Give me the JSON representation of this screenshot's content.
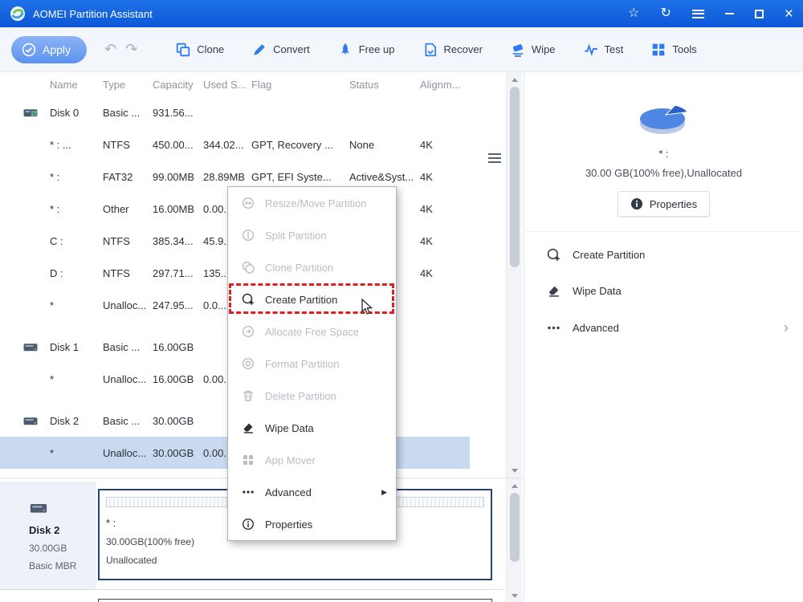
{
  "titlebar": {
    "title": "AOMEI Partition Assistant"
  },
  "toolbar": {
    "apply_label": "Apply",
    "buttons": [
      {
        "label": "Clone",
        "icon": "clone"
      },
      {
        "label": "Convert",
        "icon": "convert"
      },
      {
        "label": "Free up",
        "icon": "freeup"
      },
      {
        "label": "Recover",
        "icon": "recover"
      },
      {
        "label": "Wipe",
        "icon": "wipe"
      },
      {
        "label": "Test",
        "icon": "test"
      },
      {
        "label": "Tools",
        "icon": "tools"
      }
    ]
  },
  "table": {
    "columns": [
      "Name",
      "Type",
      "Capacity",
      "Used S...",
      "Flag",
      "Status",
      "Alignm..."
    ],
    "rows": [
      {
        "kind": "disk",
        "icon": "disk-system",
        "name": "Disk 0",
        "type": "Basic ...",
        "capacity": "931.56...",
        "used": "",
        "flag": "",
        "status": "",
        "align": ""
      },
      {
        "kind": "part",
        "name": "* : ...",
        "type": "NTFS",
        "capacity": "450.00...",
        "used": "344.02...",
        "flag": "GPT, Recovery ...",
        "status": "None",
        "align": "4K"
      },
      {
        "kind": "part",
        "name": "* :",
        "type": "FAT32",
        "capacity": "99.00MB",
        "used": "28.89MB",
        "flag": "GPT, EFI Syste...",
        "status": "Active&Syst...",
        "align": "4K"
      },
      {
        "kind": "part",
        "name": "* :",
        "type": "Other",
        "capacity": "16.00MB",
        "used": "0.00...",
        "flag": "",
        "status": "",
        "align": "4K"
      },
      {
        "kind": "part",
        "name": "C :",
        "type": "NTFS",
        "capacity": "385.34...",
        "used": "45.9...",
        "flag": "",
        "status": "",
        "align": "4K"
      },
      {
        "kind": "part",
        "name": "D :",
        "type": "NTFS",
        "capacity": "297.71...",
        "used": "135....",
        "flag": "",
        "status": "",
        "align": "4K"
      },
      {
        "kind": "part",
        "name": "*",
        "type": "Unalloc...",
        "capacity": "247.95...",
        "used": "0.0...",
        "flag": "",
        "status": "",
        "align": ""
      },
      {
        "kind": "disk",
        "icon": "disk",
        "name": "Disk 1",
        "type": "Basic ...",
        "capacity": "16.00GB",
        "used": "",
        "flag": "",
        "status": "",
        "align": ""
      },
      {
        "kind": "part",
        "name": "*",
        "type": "Unalloc...",
        "capacity": "16.00GB",
        "used": "0.00...",
        "flag": "",
        "status": "",
        "align": ""
      },
      {
        "kind": "disk",
        "icon": "disk",
        "name": "Disk 2",
        "type": "Basic ...",
        "capacity": "30.00GB",
        "used": "",
        "flag": "",
        "status": "",
        "align": ""
      },
      {
        "kind": "part",
        "name": "*",
        "type": "Unalloc...",
        "capacity": "30.00GB",
        "used": "0.00...",
        "flag": "",
        "status": "",
        "align": "",
        "selected": true
      }
    ]
  },
  "context_menu": {
    "items": [
      {
        "label": "Resize/Move Partition",
        "icon": "resize",
        "enabled": false
      },
      {
        "label": "Split Partition",
        "icon": "split",
        "enabled": false
      },
      {
        "label": "Clone Partition",
        "icon": "clonep",
        "enabled": false
      },
      {
        "label": "Create Partition",
        "icon": "create",
        "enabled": true,
        "highlighted": true
      },
      {
        "label": "Allocate Free Space",
        "icon": "allocate",
        "enabled": false
      },
      {
        "label": "Format Partition",
        "icon": "format",
        "enabled": false
      },
      {
        "label": "Delete Partition",
        "icon": "trash",
        "enabled": false
      },
      {
        "label": "Wipe Data",
        "icon": "eraser",
        "enabled": true
      },
      {
        "label": "App Mover",
        "icon": "appmover",
        "enabled": false
      },
      {
        "label": "Advanced",
        "icon": "dots",
        "enabled": true,
        "submenu": true
      },
      {
        "label": "Properties",
        "icon": "info-outline",
        "enabled": true
      }
    ]
  },
  "right_panel": {
    "partition_label": "* :",
    "partition_info": "30.00 GB(100% free),Unallocated",
    "properties_label": "Properties",
    "actions": [
      {
        "label": "Create Partition",
        "icon": "create"
      },
      {
        "label": "Wipe Data",
        "icon": "eraser"
      },
      {
        "label": "Advanced",
        "icon": "dots",
        "chevron": true
      }
    ]
  },
  "bottom_panel": {
    "disk_name": "Disk 2",
    "disk_size": "30.00GB",
    "disk_type": "Basic MBR",
    "part_label": "* :",
    "part_size": "30.00GB(100% free)",
    "part_status": "Unallocated"
  },
  "colors": {
    "titlebar_blue": "#1565e0",
    "toolbar_icon_blue": "#2d7bf2",
    "selected_row": "#c9daf0",
    "highlight_red": "#e02020",
    "pie_main": "#4e86e4",
    "pie_slice": "#2c5fc4"
  }
}
